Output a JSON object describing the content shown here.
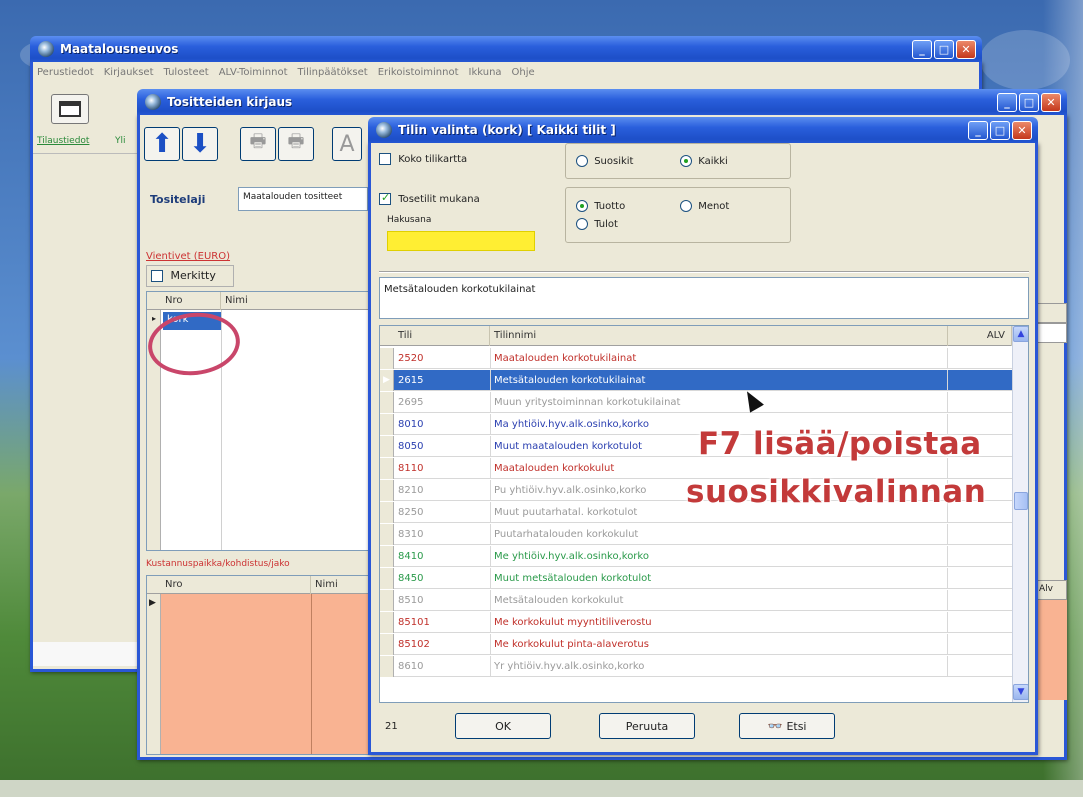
{
  "main_window": {
    "title": "Maatalousneuvos",
    "menu": [
      "Perustiedot",
      "Kirjaukset",
      "Tulosteet",
      "ALV-Toiminnot",
      "Tilinpäätökset",
      "Erikoistoiminnot",
      "Ikkuna",
      "Ohje"
    ],
    "toolbar_label": "Tilaustiedot",
    "toolbar_label2": "Yli"
  },
  "voucher_window": {
    "title": "Tositteiden kirjaus",
    "type_label": "Tositelaji",
    "type_value": "Maatalouden tositteet",
    "entries_label": "Vientivet (EURO)",
    "marked_label": "Merkitty",
    "grid_headers": [
      "Nro",
      "Nimi"
    ],
    "active_cell": "kork",
    "cost_section_label": "Kustannuspaikka/kohdistus/jako",
    "cost_headers": [
      "Nro",
      "Nimi"
    ],
    "right_cut_label": "Alv"
  },
  "account_dialog": {
    "title": "Tilin valinta  (kork) [ Kaikki tilit ]",
    "chk_whole_chart": "Koko tilikartta",
    "chk_whole_chart_checked": false,
    "chk_include": "Tosetilit mukana",
    "chk_include_checked": true,
    "search_label": "Hakusana",
    "search_value": "",
    "radio_favorites": "Suosikit",
    "radio_all": "Kaikki",
    "radio_income_expense": "Tuotto",
    "radio_expense": "Menot",
    "radio_income": "Tulot",
    "selected_name_display": "Metsätalouden korkotukilainat",
    "grid_headers": [
      "Tili",
      "Tilinnimi",
      "ALV"
    ],
    "rows": [
      {
        "account": "2520",
        "name": "Maatalouden korkotukilainat",
        "color": "#c0302a"
      },
      {
        "account": "2615",
        "name": "Metsätalouden korkotukilainat",
        "color": "#2a3fb0",
        "selected": true
      },
      {
        "account": "2695",
        "name": "Muun yritystoiminnan korkotukilainat",
        "color": "#9a9a9a"
      },
      {
        "account": "8010",
        "name": "Ma yhtiöiv.hyv.alk.osinko,korko",
        "color": "#2a3fb0"
      },
      {
        "account": "8050",
        "name": "Muut maatalouden korkotulot",
        "color": "#2a3fb0"
      },
      {
        "account": "8110",
        "name": "Maatalouden korkokulut",
        "color": "#c0302a"
      },
      {
        "account": "8210",
        "name": "Pu yhtiöiv.hyv.alk.osinko,korko",
        "color": "#9a9a9a"
      },
      {
        "account": "8250",
        "name": "Muut puutarhatal. korkotulot",
        "color": "#9a9a9a"
      },
      {
        "account": "8310",
        "name": "Puutarhatalouden korkokulut",
        "color": "#9a9a9a"
      },
      {
        "account": "8410",
        "name": "Me yhtiöiv.hyv.alk.osinko,korko",
        "color": "#2a9a4a"
      },
      {
        "account": "8450",
        "name": "Muut metsätalouden korkotulot",
        "color": "#2a9a4a"
      },
      {
        "account": "8510",
        "name": "Metsätalouden korkokulut",
        "color": "#9a9a9a"
      },
      {
        "account": "85101",
        "name": "Me korkokulut myyntitiliverostu",
        "color": "#c0302a"
      },
      {
        "account": "85102",
        "name": "Me korkokulut pinta-alaverotus",
        "color": "#c0302a"
      },
      {
        "account": "8610",
        "name": "Yr yhtiöiv.hyv.alk.osinko,korko",
        "color": "#9a9a9a"
      }
    ],
    "row_count": "21",
    "ok_label": "OK",
    "cancel_label": "Peruuta",
    "find_label": "Etsi"
  },
  "annotation": {
    "line1": "F7 lisää/poistaa",
    "line2": "suosikkivalinnan"
  },
  "colors": {
    "title_blue": "#2a5fdc",
    "selection": "#316ac5",
    "search_highlight": "#ffee33",
    "cost_grid_bg": "#f9b392",
    "annotation_red": "#c33a3a"
  }
}
